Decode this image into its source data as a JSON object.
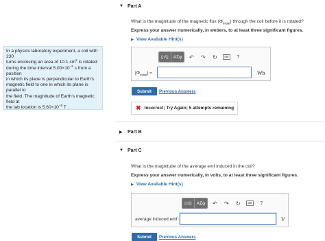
{
  "problem": {
    "l1": "In a physics laboratory experiment, a coil with 230",
    "l2a": "turns enclosing an area of 10.1 cm",
    "l2sup": "2",
    "l2b": " is rotated",
    "l3a": "during the time interval 5.00×10",
    "l3sup": "−2",
    "l3b": " s from a position",
    "l4": "in which its plane is perpendicular to Earth's",
    "l5": "magnetic field to one in which its plane is parallel to",
    "l6": "the field. The magnitude of Earth's magnetic field at",
    "l7a": "the lab location is 5.60×10",
    "l7sup": "−5",
    "l7b": " T ."
  },
  "partA": {
    "title": "Part A",
    "question": "What is the magnitude of the magnetic flux (Φ",
    "question_sub": "initial",
    "question_end": ") through the coil before it is rotated?",
    "instruction": "Express your answer numerically, in webers, to at least three significant figures.",
    "hint": "View Available Hint(s)",
    "label": "|Φ",
    "label_sub": "initial",
    "label_end": "| =",
    "unit": "Wb",
    "submit": "Submit",
    "previous": "Previous Answers",
    "feedback": "Incorrect; Try Again; 5 attempts remaining"
  },
  "partB": {
    "title": "Part B"
  },
  "partC": {
    "title": "Part C",
    "question": "What is the magnitude of the average emf induced in the coil?",
    "instruction": "Express your answer numerically, in volts, to at least three significant figures.",
    "hint": "View Available Hint(s)",
    "label": "average induced emf =",
    "unit": "V",
    "submit": "Submit",
    "previous": "Previous Answers"
  },
  "toolbar": {
    "templates": "▯√▯",
    "greek": "ΑΣφ",
    "undo": "↶",
    "redo": "↷",
    "reset": "↻",
    "keyboard": "⌨",
    "help": "?"
  }
}
